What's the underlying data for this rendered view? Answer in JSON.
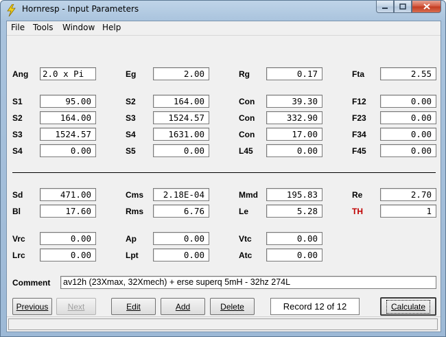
{
  "window": {
    "title": "Hornresp - Input Parameters"
  },
  "menu": [
    "File",
    "Tools",
    "Window",
    "Help"
  ],
  "rows": {
    "r1": [
      {
        "label": "Ang",
        "value": "2.0 x Pi",
        "align": "left"
      },
      {
        "label": "Eg",
        "value": "2.00"
      },
      {
        "label": "Rg",
        "value": "0.17"
      },
      {
        "label": "Fta",
        "value": "2.55"
      }
    ],
    "r2": [
      {
        "label": "S1",
        "value": "95.00"
      },
      {
        "label": "S2",
        "value": "164.00"
      },
      {
        "label": "Con",
        "value": "39.30"
      },
      {
        "label": "F12",
        "value": "0.00"
      }
    ],
    "r3": [
      {
        "label": "S2",
        "value": "164.00"
      },
      {
        "label": "S3",
        "value": "1524.57"
      },
      {
        "label": "Con",
        "value": "332.90"
      },
      {
        "label": "F23",
        "value": "0.00"
      }
    ],
    "r4": [
      {
        "label": "S3",
        "value": "1524.57"
      },
      {
        "label": "S4",
        "value": "1631.00"
      },
      {
        "label": "Con",
        "value": "17.00"
      },
      {
        "label": "F34",
        "value": "0.00"
      }
    ],
    "r5": [
      {
        "label": "S4",
        "value": "0.00"
      },
      {
        "label": "S5",
        "value": "0.00"
      },
      {
        "label": "L45",
        "value": "0.00"
      },
      {
        "label": "F45",
        "value": "0.00"
      }
    ],
    "r6": [
      {
        "label": "Sd",
        "value": "471.00"
      },
      {
        "label": "Cms",
        "value": "2.18E-04"
      },
      {
        "label": "Mmd",
        "value": "195.83"
      },
      {
        "label": "Re",
        "value": "2.70"
      }
    ],
    "r7": [
      {
        "label": "Bl",
        "value": "17.60"
      },
      {
        "label": "Rms",
        "value": "6.76"
      },
      {
        "label": "Le",
        "value": "5.28"
      },
      {
        "label": "TH",
        "value": "1"
      }
    ],
    "r8": [
      {
        "label": "Vrc",
        "value": "0.00"
      },
      {
        "label": "Ap",
        "value": "0.00"
      },
      {
        "label": "Vtc",
        "value": "0.00"
      }
    ],
    "r9": [
      {
        "label": "Lrc",
        "value": "0.00"
      },
      {
        "label": "Lpt",
        "value": "0.00"
      },
      {
        "label": "Atc",
        "value": "0.00"
      }
    ]
  },
  "comment": {
    "label": "Comment",
    "value": "av12h (23Xmax, 32Xmech) + erse superq 5mH - 32hz 274L"
  },
  "buttons": {
    "previous": "Previous",
    "next": "Next",
    "edit": "Edit",
    "add": "Add",
    "delete": "Delete",
    "calculate": "Calculate"
  },
  "record": "Record 12 of 12",
  "colors": {
    "accent_label": "#c00000",
    "titlebar": "#bfd4e8"
  },
  "icons": {
    "app": "lightning-bolt-icon",
    "minimize": "minimize-icon",
    "maximize": "maximize-icon",
    "close": "close-icon"
  }
}
